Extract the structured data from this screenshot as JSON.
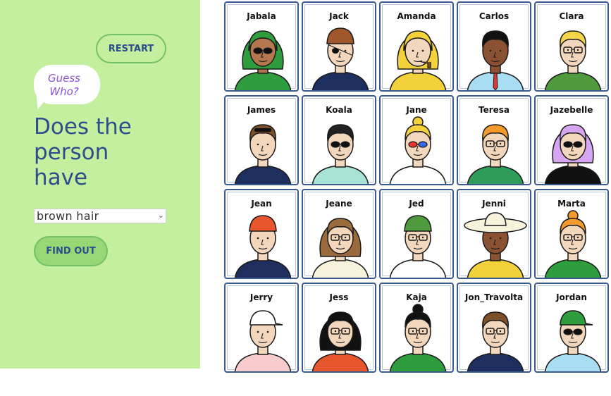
{
  "sidebar": {
    "restart_label": "RESTART",
    "bubble_line1": "Guess",
    "bubble_line2": "Who?",
    "question_line1": "Does the",
    "question_line2": "person",
    "question_line3": "have",
    "select_value": "brown hair",
    "find_label": "FIND OUT"
  },
  "colors": {
    "sidebar_bg": "#c4ef9e",
    "accent_text": "#2d4e8c",
    "bubble_text": "#8b52d4",
    "button_border": "#74c268",
    "find_button_bg": "#97d776",
    "card_border": "#3b5a8c"
  },
  "characters": [
    {
      "name": "Jabala",
      "skin": "#b5774e",
      "hair": "#2f9c3e",
      "shirt": "#2f9c3e",
      "acc": "sunglasses",
      "style": "hijab"
    },
    {
      "name": "Jack",
      "skin": "#f3d7bd",
      "hair": "#a0572c",
      "shirt": "#1e2e5e",
      "acc": "eyepatch",
      "style": "pirate"
    },
    {
      "name": "Amanda",
      "skin": "#f3d7bd",
      "hair": "#f2d13a",
      "shirt": "#f2d13a",
      "acc": "pipe",
      "style": "raincoat"
    },
    {
      "name": "Carlos",
      "skin": "#8a5232",
      "hair": "#111111",
      "shirt": "#a9ddf2",
      "acc": "tie",
      "style": "short"
    },
    {
      "name": "Clara",
      "skin": "#f3d7bd",
      "hair": "#f5d54a",
      "shirt": "#4f9a3d",
      "acc": "glasses",
      "style": "short"
    },
    {
      "name": "James",
      "skin": "#f3d7bd",
      "hair": "#7a4f2a",
      "shirt": "#1e2e5e",
      "acc": "sunglasses-top",
      "style": "short"
    },
    {
      "name": "Koala",
      "skin": "#f3d7bd",
      "hair": "#222222",
      "shirt": "#a9e3d5",
      "acc": "sunglasses",
      "style": "short"
    },
    {
      "name": "Jane",
      "skin": "#f3d7bd",
      "hair": "#f2d13a",
      "shirt": "#ffffff",
      "acc": "3d-glasses",
      "style": "bun"
    },
    {
      "name": "Teresa",
      "skin": "#f3d7bd",
      "hair": "#f39a2c",
      "shirt": "#2f9c5a",
      "acc": "glasses",
      "style": "curly"
    },
    {
      "name": "Jazebelle",
      "skin": "#f3d7bd",
      "hair": "#d7a6f2",
      "shirt": "#111111",
      "acc": "sunglasses",
      "style": "bob"
    },
    {
      "name": "Jean",
      "skin": "#f3d7bd",
      "hair": "#e8562e",
      "shirt": "#1e2e5e",
      "acc": "beanie",
      "style": "beanie"
    },
    {
      "name": "Jeane",
      "skin": "#f3d7bd",
      "hair": "#9a6a3c",
      "shirt": "#f7f2dc",
      "acc": "glasses",
      "style": "long"
    },
    {
      "name": "Jed",
      "skin": "#f3d7bd",
      "hair": "#4f9a3d",
      "shirt": "#ffffff",
      "acc": "glasses",
      "style": "beanie"
    },
    {
      "name": "Jenni",
      "skin": "#8a5232",
      "hair": "#f7f2dc",
      "shirt": "#f2d13a",
      "acc": "sunhat",
      "style": "sunhat"
    },
    {
      "name": "Marta",
      "skin": "#f3d7bd",
      "hair": "#f39a2c",
      "shirt": "#2f9c3e",
      "acc": "glasses",
      "style": "bun"
    },
    {
      "name": "Jerry",
      "skin": "#f3d7bd",
      "hair": "#ffffff",
      "shirt": "#f7cbcb",
      "acc": "cap",
      "style": "cap"
    },
    {
      "name": "Jess",
      "skin": "#f3d7bd",
      "hair": "#111111",
      "shirt": "#e8562e",
      "acc": "glasses",
      "style": "long"
    },
    {
      "name": "Kaja",
      "skin": "#f3d7bd",
      "hair": "#111111",
      "shirt": "#2f9c3e",
      "acc": "glasses",
      "style": "bun"
    },
    {
      "name": "Jon_Travolta",
      "skin": "#f3d7bd",
      "hair": "#7a4f2a",
      "shirt": "#1e2e5e",
      "acc": "glasses",
      "style": "short"
    },
    {
      "name": "Jordan",
      "skin": "#f3d7bd",
      "hair": "#2f9c3e",
      "shirt": "#a9ddf2",
      "acc": "sunglasses",
      "style": "cap"
    }
  ]
}
